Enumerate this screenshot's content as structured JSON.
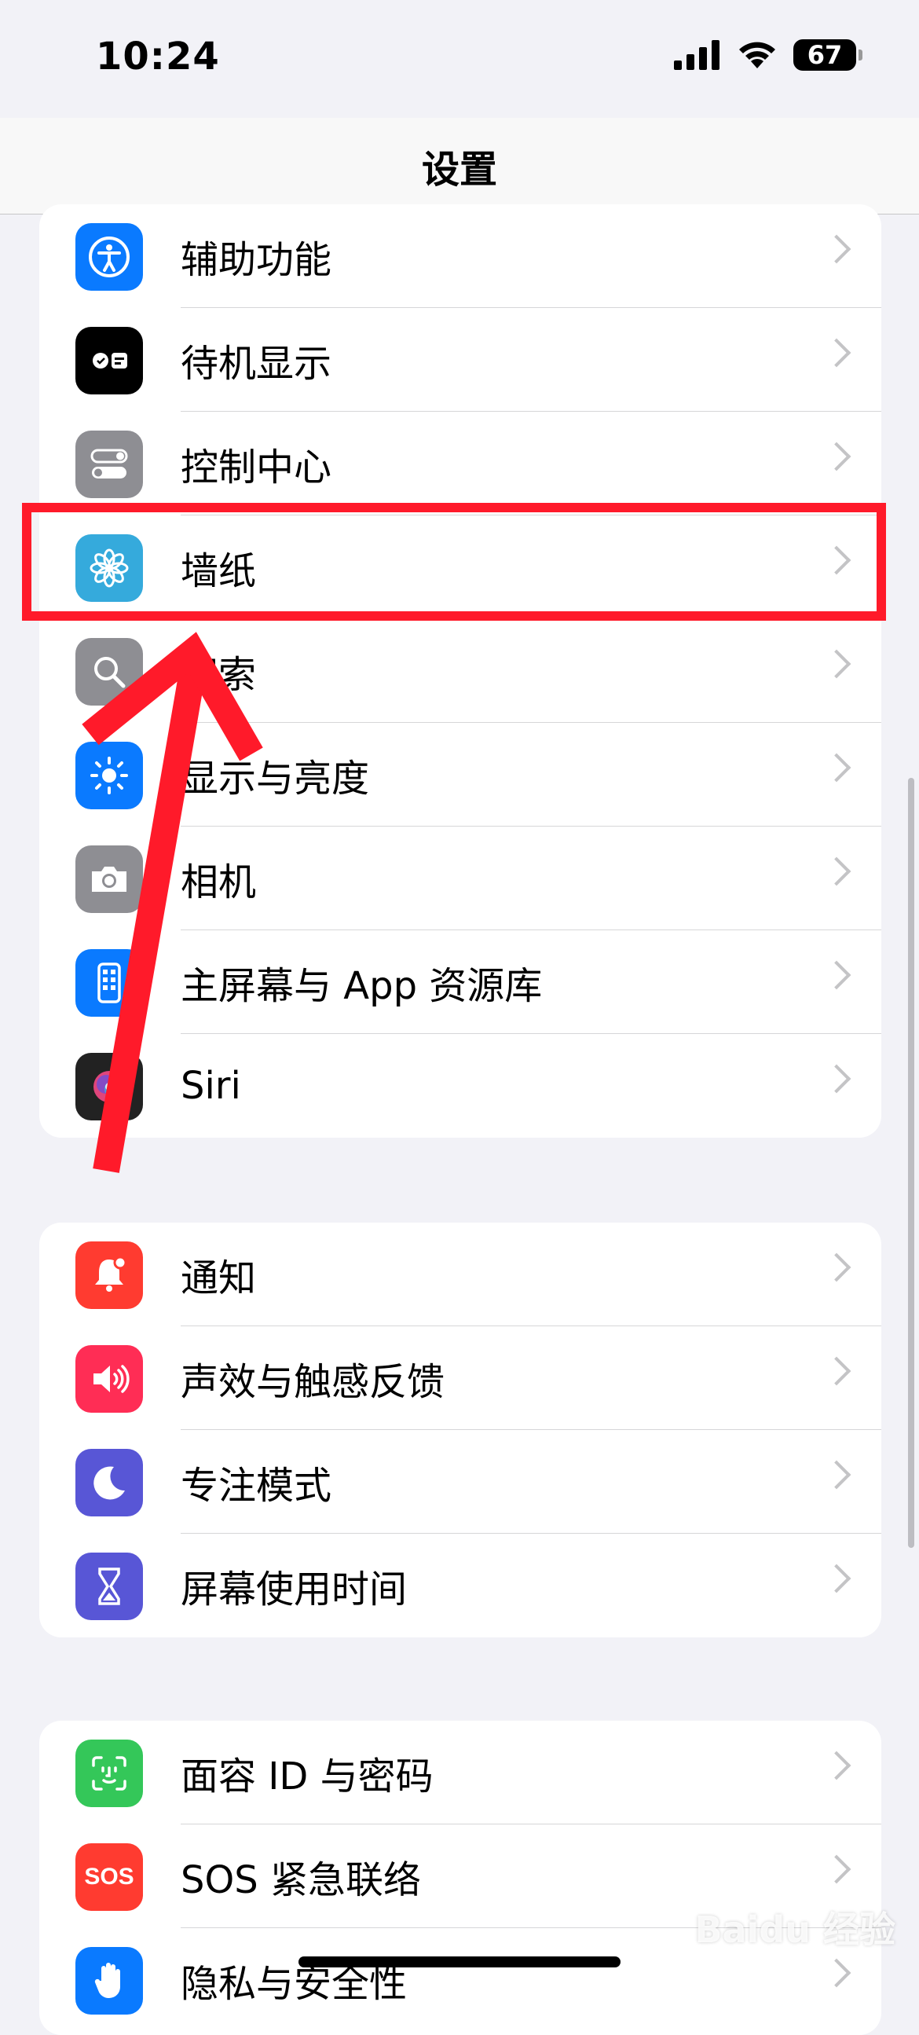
{
  "status_bar": {
    "time": "10:24",
    "battery": "67"
  },
  "nav": {
    "title": "设置"
  },
  "groups": [
    {
      "items": [
        {
          "label": "辅助功能",
          "icon": "accessibility-icon",
          "color": "#0a7aff"
        },
        {
          "label": "待机显示",
          "icon": "standby-icon",
          "color": "#000000"
        },
        {
          "label": "控制中心",
          "icon": "control-center-icon",
          "color": "#8e8e93"
        },
        {
          "label": "墙纸",
          "icon": "wallpaper-icon",
          "color": "#35aadc"
        },
        {
          "label": "搜索",
          "icon": "search-icon",
          "color": "#8e8e93"
        },
        {
          "label": "显示与亮度",
          "icon": "brightness-icon",
          "color": "#0a7aff"
        },
        {
          "label": "相机",
          "icon": "camera-icon",
          "color": "#8e8e93"
        },
        {
          "label": "主屏幕与 App 资源库",
          "icon": "home-screen-icon",
          "color": "#0a7aff"
        },
        {
          "label": "Siri",
          "icon": "siri-icon",
          "color": "#222222"
        }
      ]
    },
    {
      "items": [
        {
          "label": "通知",
          "icon": "bell-icon",
          "color": "#ff3b30"
        },
        {
          "label": "声效与触感反馈",
          "icon": "speaker-icon",
          "color": "#ff2d55"
        },
        {
          "label": "专注模式",
          "icon": "moon-icon",
          "color": "#5856d6"
        },
        {
          "label": "屏幕使用时间",
          "icon": "hourglass-icon",
          "color": "#5856d6"
        }
      ]
    },
    {
      "items": [
        {
          "label": "面容 ID 与密码",
          "icon": "face-id-icon",
          "color": "#34c759"
        },
        {
          "label": "SOS 紧急联络",
          "icon": "sos-icon",
          "color": "#ff3b30",
          "badge": "SOS"
        },
        {
          "label": "隐私与安全性",
          "icon": "hand-icon",
          "color": "#0a7aff"
        }
      ]
    }
  ],
  "watermark": "Baidu 经验"
}
